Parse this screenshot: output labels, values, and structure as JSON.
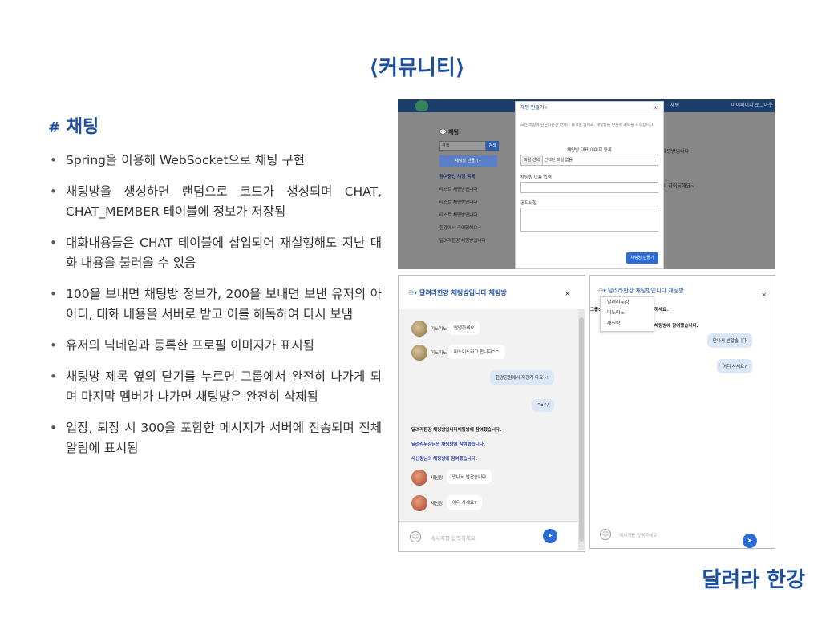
{
  "page": {
    "title": "⟨커뮤니티⟩",
    "section_hash": "#",
    "section_title": "채팅",
    "brand": "달려라 한강",
    "bullets": [
      "Spring을 이용해 WebSocket으로 채팅 구현",
      "채팅방을 생성하면 랜덤으로 코드가 생성되며 CHAT, CHAT_MEMBER 테이블에 정보가 저장됨",
      "대화내용들은 CHAT 테이블에 삽입되어 재실행해도 지난 대화 내용을 불러올 수 있음",
      "100을 보내면 채팅방 정보가, 200을 보내면 보낸 유저의 아이디, 대화 내용을 서버로 받고 이를 해독하여 다시 보냄",
      "유저의 닉네임과 등록한 프로필 이미지가 표시됨",
      "채팅방 제목 옆의 닫기를 누르면 그룹에서 완전히 나가게 되며 마지막 멤버가 나가면 채팅방은 완전히 삭제됨",
      "입장, 퇴장 시 300을 포함한 메시지가 서버에 전송되며 전체 알림에 표시됨"
    ]
  },
  "shot1": {
    "nav_item": "채팅",
    "nav_user": "마이페이지 로그아웃",
    "side_title": "채팅",
    "search_value": "검색",
    "search_button": "검색",
    "make_button": "채팅방 만들기+",
    "room_list": [
      "참여중인 채팅 목록",
      "테스트 채팅방입니다",
      "테스트 채팅방입니다",
      "테스트 채팅방입니다",
      "한강에서 라이딩해요~",
      "달려라한강 채팅방입니다"
    ],
    "right_items": [
      "채팅방입니다",
      "서 라이딩해요~"
    ],
    "modal": {
      "title": "채팅 만들기+",
      "close": "×",
      "desc": "모션 바람에 만난다는건 언제나 즐거운 일이죠. 채팅방을 만들어 대화를 시작합니다.",
      "img_label": "채팅방 대표 이미지 등록",
      "file_button": "파일 선택",
      "file_value": "선택된 파일 없음",
      "name_label": "채팅방 이름 입력",
      "notice_label": "공지사항",
      "submit": "채팅방 만들기"
    }
  },
  "shot2": {
    "title": "달려라한강 채팅방입니다 채팅방",
    "close": "×",
    "messages": [
      {
        "nick": "미노미노",
        "text": "안녕하세요"
      },
      {
        "nick": "미노미노",
        "text": "미노미노라고 합니다^^"
      }
    ],
    "my_messages": [
      "한강공원에서 자전거 타요~!",
      "^o^/"
    ],
    "system": [
      "달려라한강 채팅방입니다채팅방에 참여했습니다.",
      "달려라두강님의 채팅방에 참여했습니다.",
      "새신랑님의 채팅방에 참여했습니다."
    ],
    "messages2": [
      {
        "nick": "새신랑",
        "text": "만나서 반갑습니다"
      },
      {
        "nick": "새신랑",
        "text": "어디 사세요?"
      }
    ],
    "placeholder": "메시지를 입력하세요"
  },
  "shot3": {
    "title": "달려라한강 채팅방입니다 채팅방",
    "close": "×",
    "members": [
      "달려라두강",
      "미노미노",
      "새신랑"
    ],
    "partial1": "그룹:",
    "partial2": "하세요.",
    "partial3": "채팅방에 참여했습니다.",
    "bubbles": [
      "만나서 반갑습니다",
      "어디 사세요?"
    ],
    "placeholder": "메시지를 입력하세요"
  },
  "colors": {
    "accent": "#1d4fa0",
    "send": "#2a6bd4",
    "my_bubble": "#dbe7f7"
  }
}
